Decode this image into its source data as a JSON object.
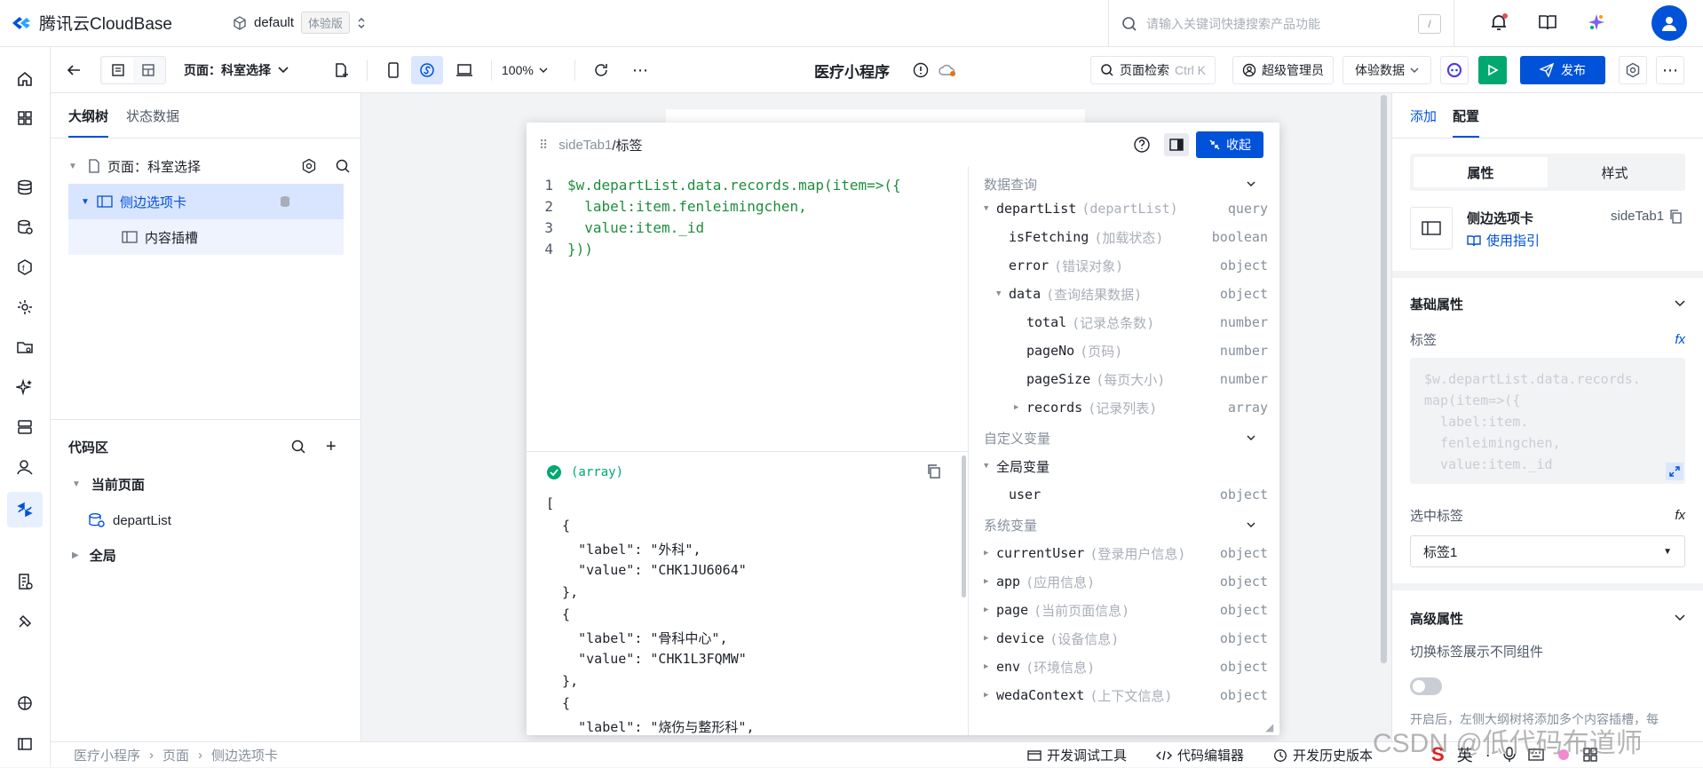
{
  "app": {
    "title": "腾讯云CloudBase"
  },
  "env": {
    "name": "default",
    "tag": "体验版"
  },
  "topsearch": {
    "placeholder": "请输入关键词快捷搜索产品功能",
    "key": "/"
  },
  "toolbar": {
    "page_select": "页面：科室选择",
    "zoom": "100%",
    "project_name": "医疗小程序",
    "page_search": "页面检索",
    "page_search_shortcut": "Ctrl K",
    "role": "超级管理员",
    "data_mode": "体验数据",
    "publish": "发布"
  },
  "outline": {
    "tabs": [
      "大纲树",
      "状态数据"
    ],
    "tree": [
      {
        "label": "页面：科室选择"
      },
      {
        "label": "侧边选项卡"
      },
      {
        "label": "内容插槽"
      }
    ]
  },
  "codearea": {
    "title": "代码区",
    "groups": [
      "当前页面",
      "全局"
    ],
    "items": [
      "departList"
    ]
  },
  "modal": {
    "breadcrumb_parent": "sideTab1",
    "breadcrumb_current": "/标签",
    "collapse": "收起",
    "code": [
      "$w.departList.data.records.map(item=>({",
      "  label:item.fenleimingchen,",
      "  value:item._id",
      "}))"
    ],
    "result_type": "(array)",
    "result_lines": [
      "[",
      "  {",
      "    \"label\": \"外科\",",
      "    \"value\": \"CHK1JU6064\"",
      "  },",
      "  {",
      "    \"label\": \"骨科中心\",",
      "    \"value\": \"CHK1L3FQMW\"",
      "  },",
      "  {",
      "    \"label\": \"烧伤与整形科\","
    ],
    "sections": {
      "data_query": "数据查询",
      "custom_vars": "自定义变量",
      "system_vars": "系统变量"
    },
    "vars": [
      {
        "name": "departList",
        "desc": "(departList)",
        "type": "query"
      },
      {
        "name": "isFetching",
        "desc": "(加载状态)",
        "type": "boolean"
      },
      {
        "name": "error",
        "desc": "(错误对象)",
        "type": "object"
      },
      {
        "name": "data",
        "desc": "(查询结果数据)",
        "type": "object"
      },
      {
        "name": "total",
        "desc": "(记录总条数)",
        "type": "number"
      },
      {
        "name": "pageNo",
        "desc": "(页码)",
        "type": "number"
      },
      {
        "name": "pageSize",
        "desc": "(每页大小)",
        "type": "number"
      },
      {
        "name": "records",
        "desc": "(记录列表)",
        "type": "array"
      },
      {
        "name": "全局变量",
        "desc": "",
        "type": ""
      },
      {
        "name": "user",
        "desc": "",
        "type": "object"
      },
      {
        "name": "currentUser",
        "desc": "(登录用户信息)",
        "type": "object"
      },
      {
        "name": "app",
        "desc": "(应用信息)",
        "type": "object"
      },
      {
        "name": "page",
        "desc": "(当前页面信息)",
        "type": "object"
      },
      {
        "name": "device",
        "desc": "(设备信息)",
        "type": "object"
      },
      {
        "name": "env",
        "desc": "(环境信息)",
        "type": "object"
      },
      {
        "name": "wedaContext",
        "desc": "(上下文信息)",
        "type": "object"
      }
    ]
  },
  "rpanel": {
    "tabs": [
      "添加",
      "配置"
    ],
    "segments": [
      "属性",
      "样式"
    ],
    "component_name": "侧边选项卡",
    "component_id": "sideTab1",
    "guide": "使用指引",
    "basic_props": "基础属性",
    "label_field": "标签",
    "label_expr": "$w.departList.data.records.\nmap(item=>({\n  label:item.\n  fenleimingchen,\n  value:item._id\n...",
    "selected_label_field": "选中标签",
    "selected_value": "标签1",
    "advanced_props": "高级属性",
    "switch_label": "切换标签展示不同组件",
    "hint": "开启后，左侧大纲树将添加多个内容插槽，每"
  },
  "bottom": {
    "crumbs": [
      "医疗小程序",
      "页面",
      "侧边选项卡"
    ],
    "tools": [
      "开发调试工具",
      "代码编辑器",
      "开发历史版本"
    ]
  },
  "watermark": "CSDN @低代码布道师",
  "ime": "英",
  "colors": {
    "primary": "#0052d9",
    "green": "#00a870"
  }
}
